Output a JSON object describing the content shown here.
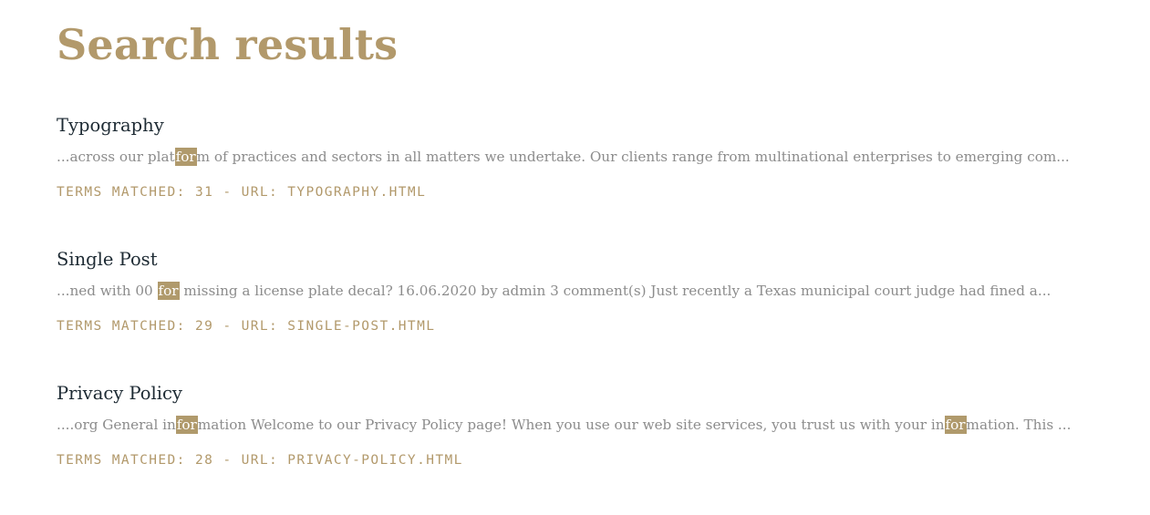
{
  "page": {
    "title": "Search results"
  },
  "results": [
    {
      "title": "Typography",
      "excerpt": [
        {
          "text": "...across our plat",
          "hl": false
        },
        {
          "text": "for",
          "hl": true
        },
        {
          "text": "m of practices and sectors in all matters we undertake. Our clients range from multinational enterprises to emerging com...",
          "hl": false
        }
      ],
      "meta_prefix": "TERMS MATCHED: 31 - URL: ",
      "url": "TYPOGRAPHY.HTML"
    },
    {
      "title": "Single Post",
      "excerpt": [
        {
          "text": "...ned with 00 ",
          "hl": false
        },
        {
          "text": "for",
          "hl": true
        },
        {
          "text": " missing a license plate decal? 16.06.2020 by admin 3 comment(s) Just recently a Texas municipal court judge had fined a...",
          "hl": false
        }
      ],
      "meta_prefix": "TERMS MATCHED: 29 - URL: ",
      "url": "SINGLE-POST.HTML"
    },
    {
      "title": "Privacy Policy",
      "excerpt": [
        {
          "text": "....org General in",
          "hl": false
        },
        {
          "text": "for",
          "hl": true
        },
        {
          "text": "mation Welcome to our Privacy Policy page! When you use our web site services, you trust us with your in",
          "hl": false
        },
        {
          "text": "for",
          "hl": true
        },
        {
          "text": "mation. This ...",
          "hl": false
        }
      ],
      "meta_prefix": "TERMS MATCHED: 28 - URL: ",
      "url": "PRIVACY-POLICY.HTML"
    }
  ],
  "colors": {
    "accent": "#b2996b",
    "highlight_bg": "#b09a6c",
    "title_text": "#1d2a33",
    "excerpt_text": "#8c8c8c"
  }
}
